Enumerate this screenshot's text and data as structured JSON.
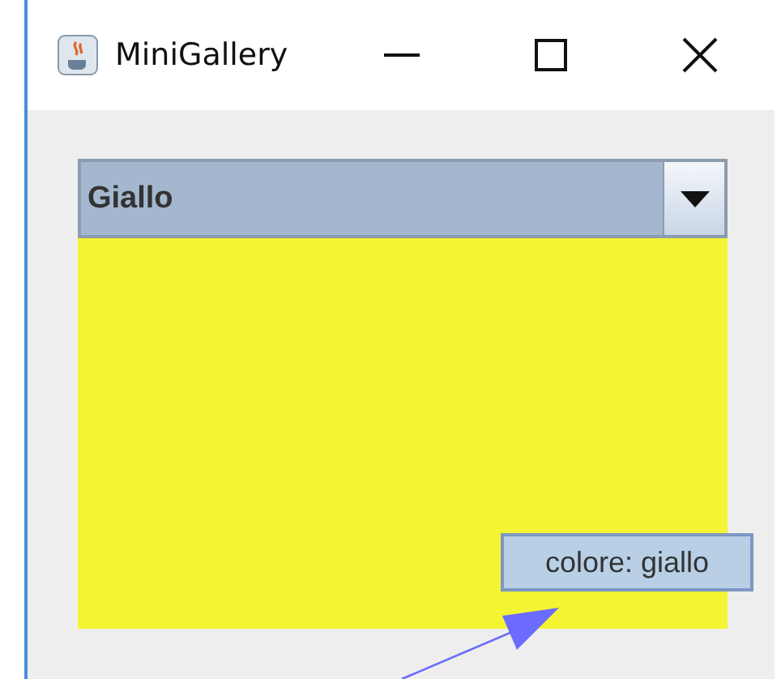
{
  "window": {
    "title": "MiniGallery"
  },
  "combo": {
    "value": "Giallo",
    "expanded": false
  },
  "panel": {
    "color": "#f4f433"
  },
  "tooltip": {
    "text": "colore: giallo"
  }
}
